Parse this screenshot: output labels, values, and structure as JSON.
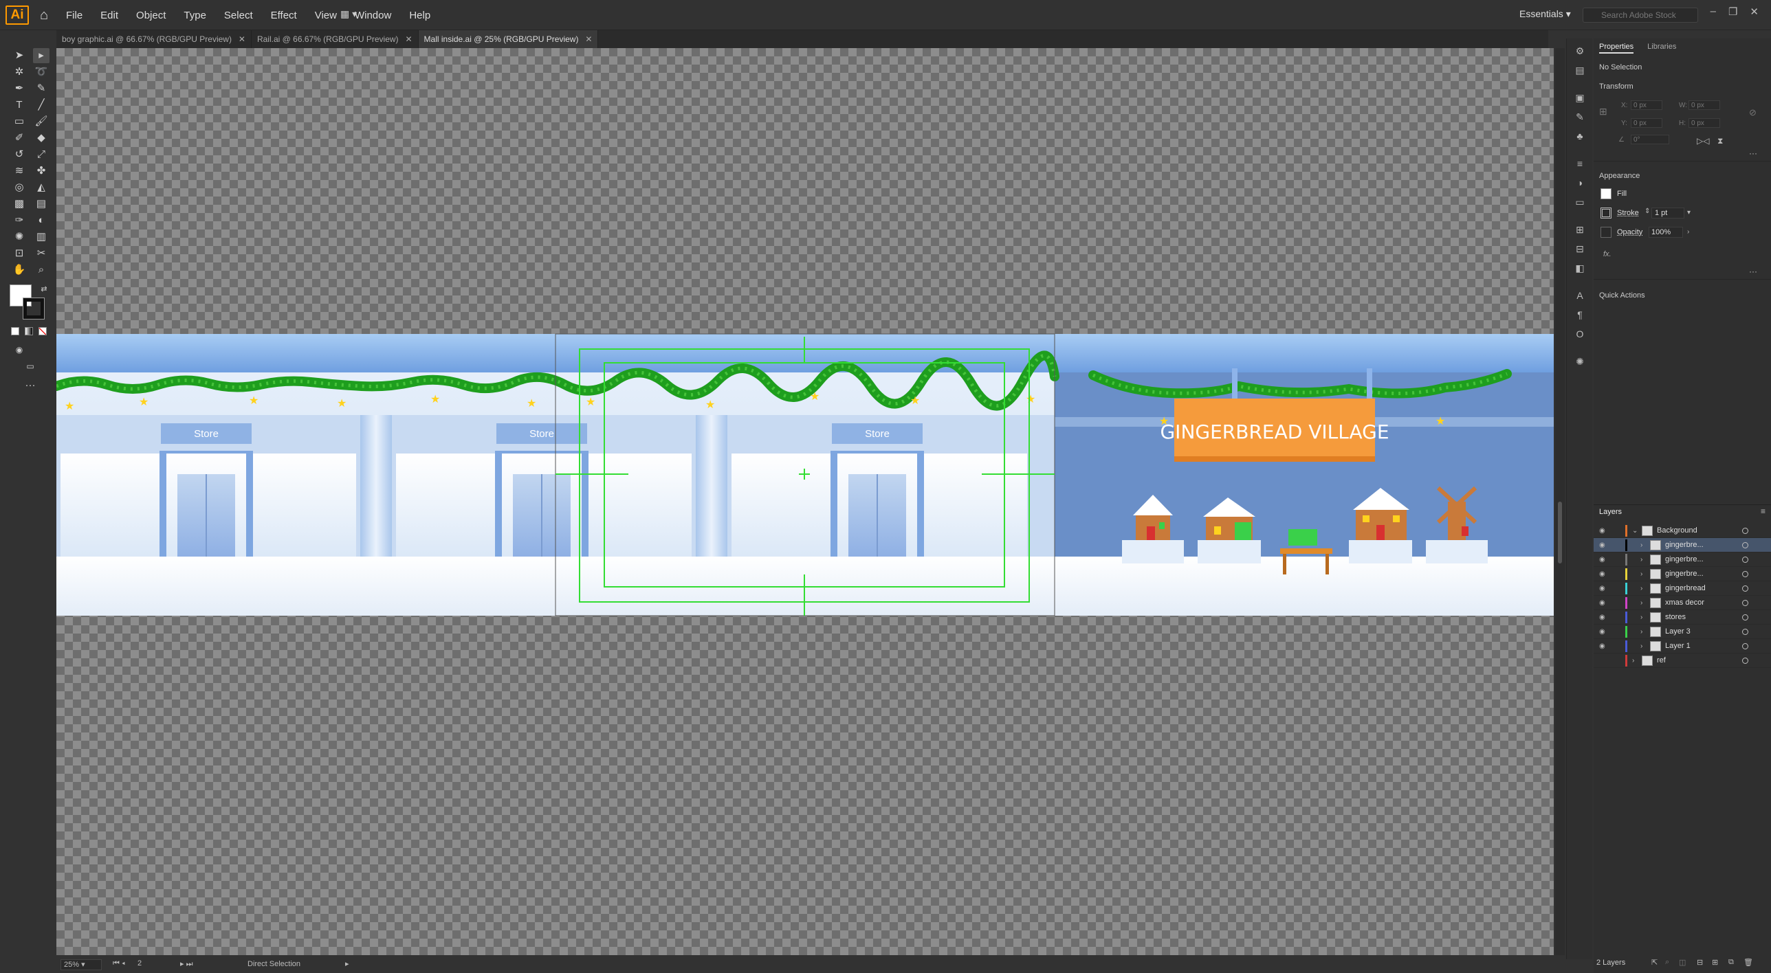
{
  "app": {
    "logo": "Ai",
    "workspace": "Essentials",
    "search_placeholder": "Search Adobe Stock"
  },
  "menu": [
    "File",
    "Edit",
    "Object",
    "Type",
    "Select",
    "Effect",
    "View",
    "Window",
    "Help"
  ],
  "tabs": [
    {
      "label": "boy graphic.ai @ 66.67% (RGB/GPU Preview)",
      "active": false
    },
    {
      "label": "Rail.ai @ 66.67% (RGB/GPU Preview)",
      "active": false
    },
    {
      "label": "Mall inside.ai @ 25% (RGB/GPU Preview)",
      "active": true
    }
  ],
  "artwork": {
    "store_label": "Store",
    "sign_text": "GINGERBREAD VILLAGE",
    "colors": {
      "ceiling": "#8db8ec",
      "wall_light": "#dce9f8",
      "wall_blue": "#6a8fc8",
      "floor": "#f4f7fb",
      "garland": "#1e9e1e",
      "sign": "#f59b3c",
      "selection": "#33dd33"
    }
  },
  "status": {
    "zoom": "25%",
    "artboard": "2",
    "tool": "Direct Selection"
  },
  "properties": {
    "tabs": [
      "Properties",
      "Libraries"
    ],
    "selection": "No Selection",
    "transform_title": "Transform",
    "x_label": "X:",
    "y_label": "Y:",
    "w_label": "W:",
    "h_label": "H:",
    "x_val": "0 px",
    "y_val": "0 px",
    "w_val": "0 px",
    "h_val": "0 px",
    "angle_val": "0°",
    "appearance_title": "Appearance",
    "fill_label": "Fill",
    "stroke_label": "Stroke",
    "stroke_value": "1 pt",
    "opacity_label": "Opacity",
    "opacity_value": "100%",
    "fx": "fx.",
    "quick_actions": "Quick Actions"
  },
  "layers": {
    "title": "Layers",
    "count": "2 Layers",
    "items": [
      {
        "name": "Background",
        "level": 0,
        "expanded": true,
        "selected": false,
        "color": "#e0702a"
      },
      {
        "name": "gingerbre...",
        "level": 1,
        "selected": true,
        "color": "#000000"
      },
      {
        "name": "gingerbre...",
        "level": 1,
        "selected": false,
        "color": "#777777"
      },
      {
        "name": "gingerbre...",
        "level": 1,
        "selected": false,
        "color": "#e6d23a"
      },
      {
        "name": "gingerbread",
        "level": 1,
        "selected": false,
        "color": "#3ad0d6"
      },
      {
        "name": "xmas decor",
        "level": 1,
        "selected": false,
        "color": "#d043c8"
      },
      {
        "name": "stores",
        "level": 1,
        "selected": false,
        "color": "#4a5bd8"
      },
      {
        "name": "Layer 3",
        "level": 1,
        "selected": false,
        "color": "#3ad04a"
      },
      {
        "name": "Layer 1",
        "level": 1,
        "selected": false,
        "color": "#4a5bd8"
      },
      {
        "name": "ref",
        "level": 0,
        "selected": false,
        "color": "#d03a3a"
      }
    ]
  }
}
